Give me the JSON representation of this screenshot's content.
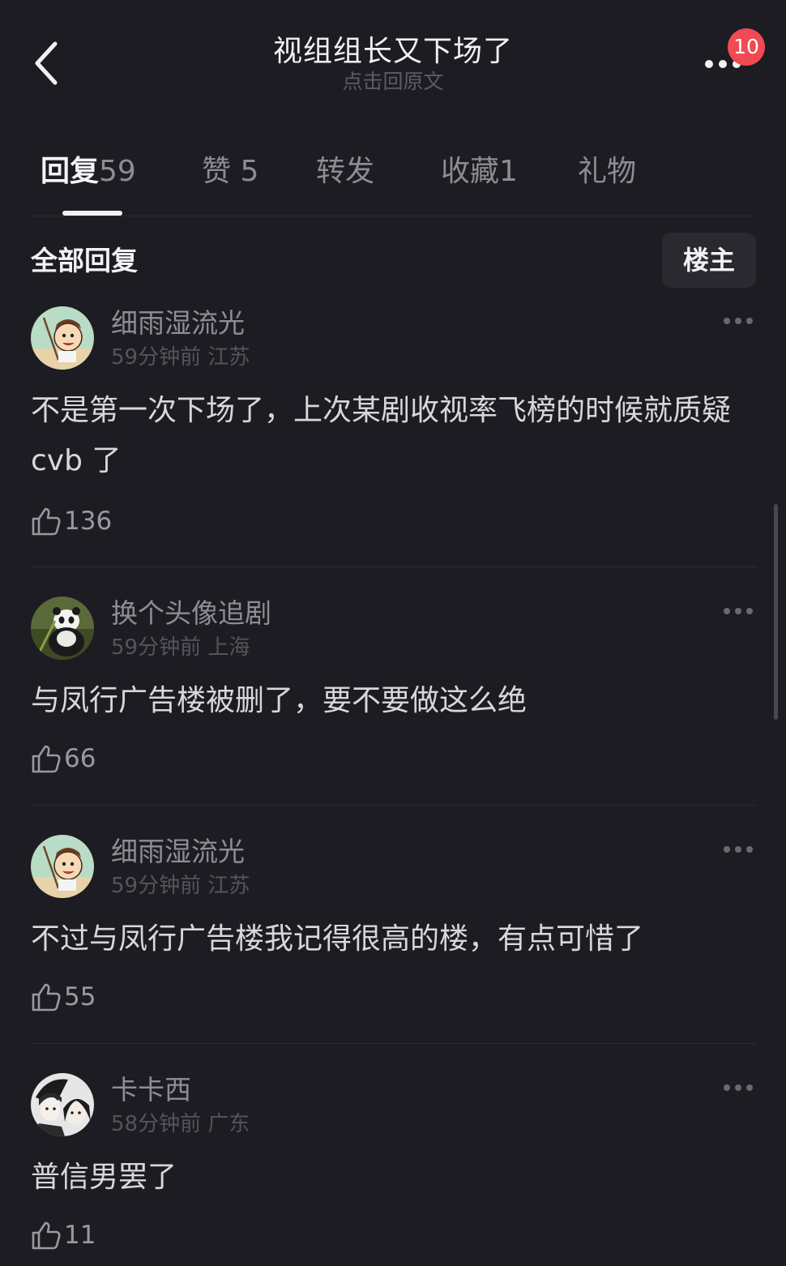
{
  "header": {
    "title": "视组组长又下场了",
    "subtitle": "点击回原文",
    "notification_count": "10"
  },
  "tabs": [
    {
      "label": "回复",
      "count": "59",
      "active": true
    },
    {
      "label": "赞",
      "count": "5"
    },
    {
      "label": "转发",
      "count": ""
    },
    {
      "label": "收藏",
      "count": "1"
    },
    {
      "label": "礼物",
      "count": ""
    }
  ],
  "section": {
    "title": "全部回复",
    "owner_filter_label": "楼主"
  },
  "comments": [
    {
      "username": "细雨湿流光",
      "time": "59分钟前",
      "location": "江苏",
      "text": "不是第一次下场了，上次某剧收视率飞榜的时候就质疑 cvb 了",
      "likes": "136",
      "avatar": "cartoon-boy-avatar"
    },
    {
      "username": "换个头像追剧",
      "time": "59分钟前",
      "location": "上海",
      "text": "与凤行广告楼被删了，要不要做这么绝",
      "likes": "66",
      "avatar": "panda-avatar"
    },
    {
      "username": "细雨湿流光",
      "time": "59分钟前",
      "location": "江苏",
      "text": "不过与凤行广告楼我记得很高的楼，有点可惜了",
      "likes": "55",
      "avatar": "cartoon-boy-avatar"
    },
    {
      "username": "卡卡西",
      "time": "58分钟前",
      "location": "广东",
      "text": "普信男罢了",
      "likes": "11",
      "avatar": "anime-avatar"
    }
  ],
  "colors": {
    "background": "#1d1c22",
    "badge": "#f04a53",
    "primary_text": "#f2f2f4",
    "secondary_text": "#8e8d94"
  }
}
